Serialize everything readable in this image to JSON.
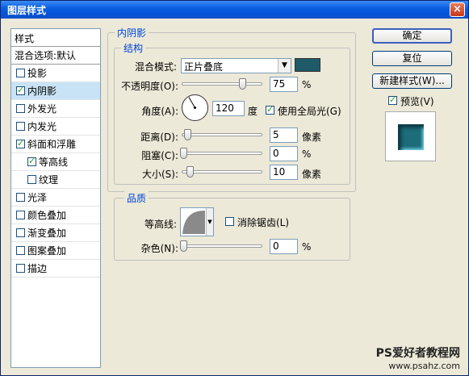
{
  "window": {
    "title": "图层样式",
    "close_label": "×"
  },
  "style_list": {
    "header": "样式",
    "blend_options": "混合选项:默认",
    "items": [
      {
        "label": "投影",
        "checked": false
      },
      {
        "label": "内阴影",
        "checked": true,
        "selected": true
      },
      {
        "label": "外发光",
        "checked": false
      },
      {
        "label": "内发光",
        "checked": false
      },
      {
        "label": "斜面和浮雕",
        "checked": true
      },
      {
        "label": "等高线",
        "checked": true,
        "sub": true
      },
      {
        "label": "纹理",
        "checked": false,
        "sub": true
      },
      {
        "label": "光泽",
        "checked": false
      },
      {
        "label": "颜色叠加",
        "checked": false
      },
      {
        "label": "渐变叠加",
        "checked": false
      },
      {
        "label": "图案叠加",
        "checked": false
      },
      {
        "label": "描边",
        "checked": false
      }
    ]
  },
  "inner_shadow": {
    "section_title": "内阴影",
    "structure_title": "结构",
    "blend_mode_label": "混合模式:",
    "blend_mode_value": "正片叠底",
    "shadow_color": "#1f5a68",
    "opacity_label": "不透明度(O):",
    "opacity_value": "75",
    "opacity_unit": "%",
    "opacity_level": 0.75,
    "angle_label": "角度(A):",
    "angle_value": "120",
    "angle_unit": "度",
    "global_light_label": "使用全局光(G)",
    "global_light_checked": true,
    "distance_label": "距离(D):",
    "distance_value": "5",
    "distance_unit": "像素",
    "choke_label": "阻塞(C):",
    "choke_value": "0",
    "choke_unit": "%",
    "size_label": "大小(S):",
    "size_value": "10",
    "size_unit": "像素"
  },
  "quality": {
    "title": "品质",
    "contour_label": "等高线:",
    "anti_alias_label": "消除锯齿(L)",
    "anti_alias_checked": false,
    "noise_label": "杂色(N):",
    "noise_value": "0",
    "noise_unit": "%"
  },
  "buttons": {
    "ok": "确定",
    "reset": "复位",
    "new_style": "新建样式(W)...",
    "preview_label": "预览(V)",
    "preview_checked": true
  },
  "watermark": {
    "line1": "PS爱好者教程网",
    "line2": "www.psahz.com"
  }
}
